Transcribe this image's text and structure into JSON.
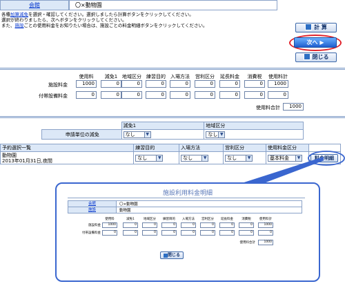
{
  "header": {
    "facility_label": "会館",
    "facility_value": "〇×動物園"
  },
  "instructions": {
    "line1_a": "各種",
    "line1_link": "加算減免",
    "line1_b": "を選択・確認してください。選択しましたら計算ボタンをクリックしてください。",
    "line2": "選択が終わりましたら、次へボタンをクリックしてください。",
    "line3_a": "また、",
    "line3_link": "施設",
    "line3_b": "ごとの使用料金をお知りたい場合は、施設ごとの料金明細ボタンをクリックしてください。"
  },
  "buttons": {
    "calc": "計 算",
    "next": "次へ",
    "close": "閉じる",
    "fee_detail": "料金明細"
  },
  "fee_table": {
    "headers": [
      "使用料",
      "減免1",
      "地域区分",
      "練習目的",
      "入場方法",
      "営利区分",
      "延長料金",
      "消費税",
      "使用料計"
    ],
    "rows": [
      {
        "label": "施設料金",
        "values": [
          "1000",
          "0",
          "0",
          "0",
          "0",
          "0",
          "0",
          "0",
          "1000"
        ]
      },
      {
        "label": "付帯設備料金",
        "values": [
          "0",
          "0",
          "0",
          "0",
          "0",
          "0",
          "0",
          "0",
          "0"
        ]
      }
    ],
    "total_label": "使用料合計",
    "total_value": "1000"
  },
  "bulk_discount": {
    "col1": "減免1",
    "col2": "地域区分",
    "row_label": "申請単位の減免",
    "sel1": "なし",
    "sel2": "なし"
  },
  "booking_list": {
    "title": "予約選択一覧",
    "headers": [
      "練習目的",
      "入場方法",
      "営利区分",
      "使用料金区分"
    ],
    "facility": "動物園",
    "datetime": "2013年01月31日,夜間",
    "selections": [
      "なし",
      "なし",
      "なし",
      "基本料金"
    ]
  },
  "popup": {
    "title": "施設利用料金明細",
    "facility_label": "会館",
    "facility_value": "〇×動物園",
    "room_label": "施設",
    "room_value": "動物園",
    "headers": [
      "使用料",
      "減免1",
      "地域区分",
      "練習目的",
      "入場方法",
      "営利区分",
      "延長料金",
      "消費税",
      "使用料計"
    ],
    "rows": [
      {
        "label": "施設料金",
        "values": [
          "1000",
          "0",
          "0",
          "0",
          "0",
          "0",
          "0",
          "0",
          "1000"
        ]
      },
      {
        "label": "付帯設備料金",
        "values": [
          "0",
          "0",
          "0",
          "0",
          "0",
          "0",
          "0",
          "0",
          "0"
        ]
      }
    ],
    "total_label": "使用料合計",
    "total_value": "1000",
    "close": "閉じる"
  },
  "colors": {
    "accent": "#3a66cf",
    "highlight_ring": "#e0222b",
    "header_bg": "#dce8f7"
  }
}
